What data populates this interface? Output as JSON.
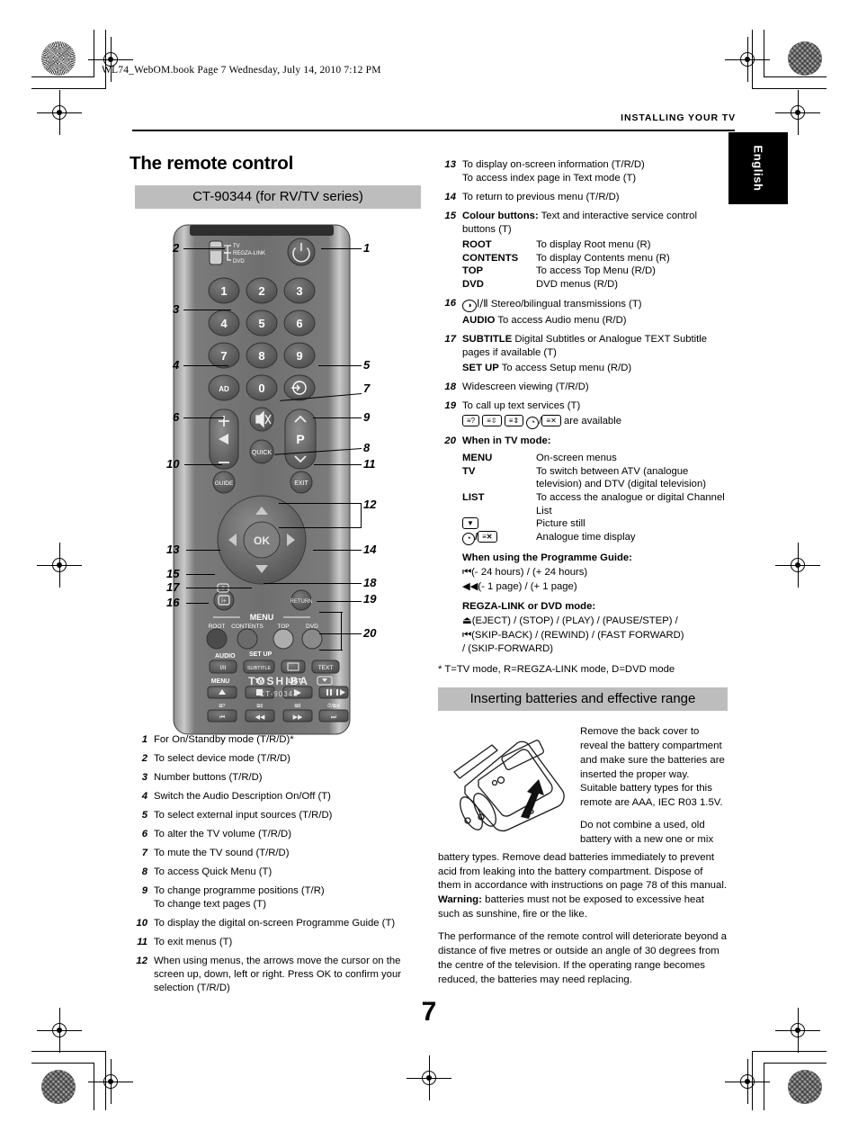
{
  "print_header": {
    "file_line": "WL74_WebOM.book  Page 7  Wednesday, July 14, 2010  7:12 PM",
    "running_head": "INSTALLING YOUR TV",
    "language_tab": "English"
  },
  "page_number": "7",
  "left_column": {
    "title": "The remote control",
    "model_bar": "CT-90344 (for RV/TV series)",
    "items": [
      {
        "n": "1",
        "lines": [
          "For On/Standby mode (T/R/D)*"
        ]
      },
      {
        "n": "2",
        "lines": [
          "To select device mode (T/R/D)"
        ]
      },
      {
        "n": "3",
        "lines": [
          "Number buttons (T/R/D)"
        ]
      },
      {
        "n": "4",
        "lines": [
          "Switch the Audio Description On/Off (T)"
        ]
      },
      {
        "n": "5",
        "lines": [
          "To select external input sources (T/R/D)"
        ]
      },
      {
        "n": "6",
        "lines": [
          "To alter the TV volume (T/R/D)"
        ]
      },
      {
        "n": "7",
        "lines": [
          "To mute the TV sound (T/R/D)"
        ]
      },
      {
        "n": "8",
        "lines": [
          "To access Quick Menu (T)"
        ]
      },
      {
        "n": "9",
        "lines": [
          "To change programme positions (T/R)",
          "To change text pages (T)"
        ]
      },
      {
        "n": "10",
        "lines": [
          "To display the digital on-screen Programme Guide (T)"
        ]
      },
      {
        "n": "11",
        "lines": [
          "To exit menus (T)"
        ]
      },
      {
        "n": "12",
        "lines": [
          "When using menus, the arrows move the cursor on the screen up, down, left or right. Press OK to confirm your selection (T/R/D)"
        ]
      }
    ]
  },
  "right_column": {
    "items": [
      {
        "n": "13",
        "lines": [
          "To display on-screen information (T/R/D)",
          "To access index page in Text mode (T)"
        ]
      },
      {
        "n": "14",
        "lines": [
          "To return to previous menu (T/R/D)"
        ]
      },
      {
        "n": "15",
        "lead_bold": "Colour buttons:",
        "lead_rest": " Text and interactive service control buttons (T)",
        "table": [
          {
            "key": "ROOT",
            "desc": "To display Root menu (R)"
          },
          {
            "key": "CONTENTS",
            "desc": "To display Contents menu (R)"
          },
          {
            "key": "TOP",
            "desc": "To access Top Menu (R/D)"
          },
          {
            "key": "DVD",
            "desc": "DVD menus (R/D)"
          }
        ]
      },
      {
        "n": "16",
        "icon_line": "Stereo/bilingual transmissions (T)",
        "sub_bold": "AUDIO",
        "sub_rest": " To access Audio menu (R/D)"
      },
      {
        "n": "17",
        "lead_bold": "SUBTITLE",
        "lead_rest": " Digital Subtitles or Analogue TEXT Subtitle pages if available (T)",
        "sub_bold": "SET UP",
        "sub_rest": " To access Setup menu (R/D)"
      },
      {
        "n": "18",
        "lines": [
          "Widescreen viewing (T/R/D)"
        ]
      },
      {
        "n": "19",
        "lines": [
          "To call up text services (T)"
        ],
        "icons_line_tail": "are available"
      },
      {
        "n": "20",
        "heading": "When in TV mode:",
        "table": [
          {
            "key": "MENU",
            "desc": "On-screen menus"
          },
          {
            "key": "TV",
            "desc": "To switch between ATV (analogue television) and DTV (digital television)"
          },
          {
            "key": "LIST",
            "desc": "To access the analogue or digital Channel List"
          },
          {
            "key": "",
            "desc": "Picture still",
            "key_icon": "down-arrow-box"
          },
          {
            "key": "",
            "desc": "Analogue time display",
            "key_icon": "clock-cancel"
          }
        ],
        "guide_heading": "When using the Programme Guide:",
        "guide_lines": [
          "(- 24 hours) /  (+ 24 hours)",
          "(- 1 page) /  (+ 1 page)"
        ],
        "regza_heading": "REGZA-LINK or DVD mode:",
        "regza_lines": [
          "(EJECT) /  (STOP) /  (PLAY) /  (PAUSE/STEP) /",
          "(SKIP-BACK) /  (REWIND) /  (FAST FORWARD)",
          "/  (SKIP-FORWARD)"
        ]
      }
    ],
    "footnote": "* T=TV mode, R=REGZA-LINK mode, D=DVD mode",
    "battery_bar": "Inserting batteries and effective range",
    "battery_paras": [
      "Remove the back cover to reveal the battery compartment and make sure the batteries are inserted the proper way. Suitable battery types for this remote are AAA, IEC R03 1.5V.",
      "Do not combine a used, old battery with a new one or mix",
      "battery types. Remove dead batteries immediately to prevent acid from leaking into the battery compartment. Dispose of them in accordance with instructions on page 78 of this manual. ",
      "batteries must not be exposed to excessive heat such as sunshine, fire or the like.",
      "The performance of the remote control will deteriorate beyond a distance of five metres or outside an angle of 30 degrees from the centre of the television. If the operating range becomes reduced, the batteries may need replacing."
    ],
    "battery_warning_label": "Warning:"
  },
  "remote": {
    "brand": "TOSHIBA",
    "model": "CT-90344",
    "mode_switch": [
      "TV",
      "REGZA-LINK",
      "DVD"
    ],
    "number_keys": [
      "1",
      "2",
      "3",
      "4",
      "5",
      "6",
      "7",
      "8",
      "9",
      "AD",
      "0"
    ],
    "p_label": "P",
    "ok_label": "OK",
    "quick_label": "QUICK",
    "guide_label": "GUIDE",
    "exit_label": "EXIT",
    "return_label": "RETURN",
    "info_label": "i+",
    "menu_group_label": "MENU",
    "colour_labels": [
      "ROOT",
      "CONTENTS",
      "TOP",
      "DVD"
    ],
    "audio_label": "AUDIO",
    "setup_label": "SET UP",
    "audio_btn": "I/II",
    "subtitle_btn": "SUBTITLE",
    "text_btn": "TEXT",
    "row_labels": [
      "MENU",
      "TV",
      "LIST"
    ],
    "callouts": [
      "1",
      "2",
      "3",
      "4",
      "5",
      "6",
      "7",
      "8",
      "9",
      "10",
      "11",
      "12",
      "13",
      "14",
      "15",
      "16",
      "17",
      "18",
      "19",
      "20"
    ],
    "colors": {
      "body": "#6f6f6f",
      "body_light": "#9a9a9a",
      "key": "#585858",
      "key_dark": "#4a4a4a",
      "top_strip": "#3a3a3a",
      "colour_btn_1": "#4b4b4b",
      "colour_btn_2": "#6b6b6b",
      "colour_btn_3": "#9d9d9d",
      "colour_btn_4": "#7d7d7d"
    }
  }
}
